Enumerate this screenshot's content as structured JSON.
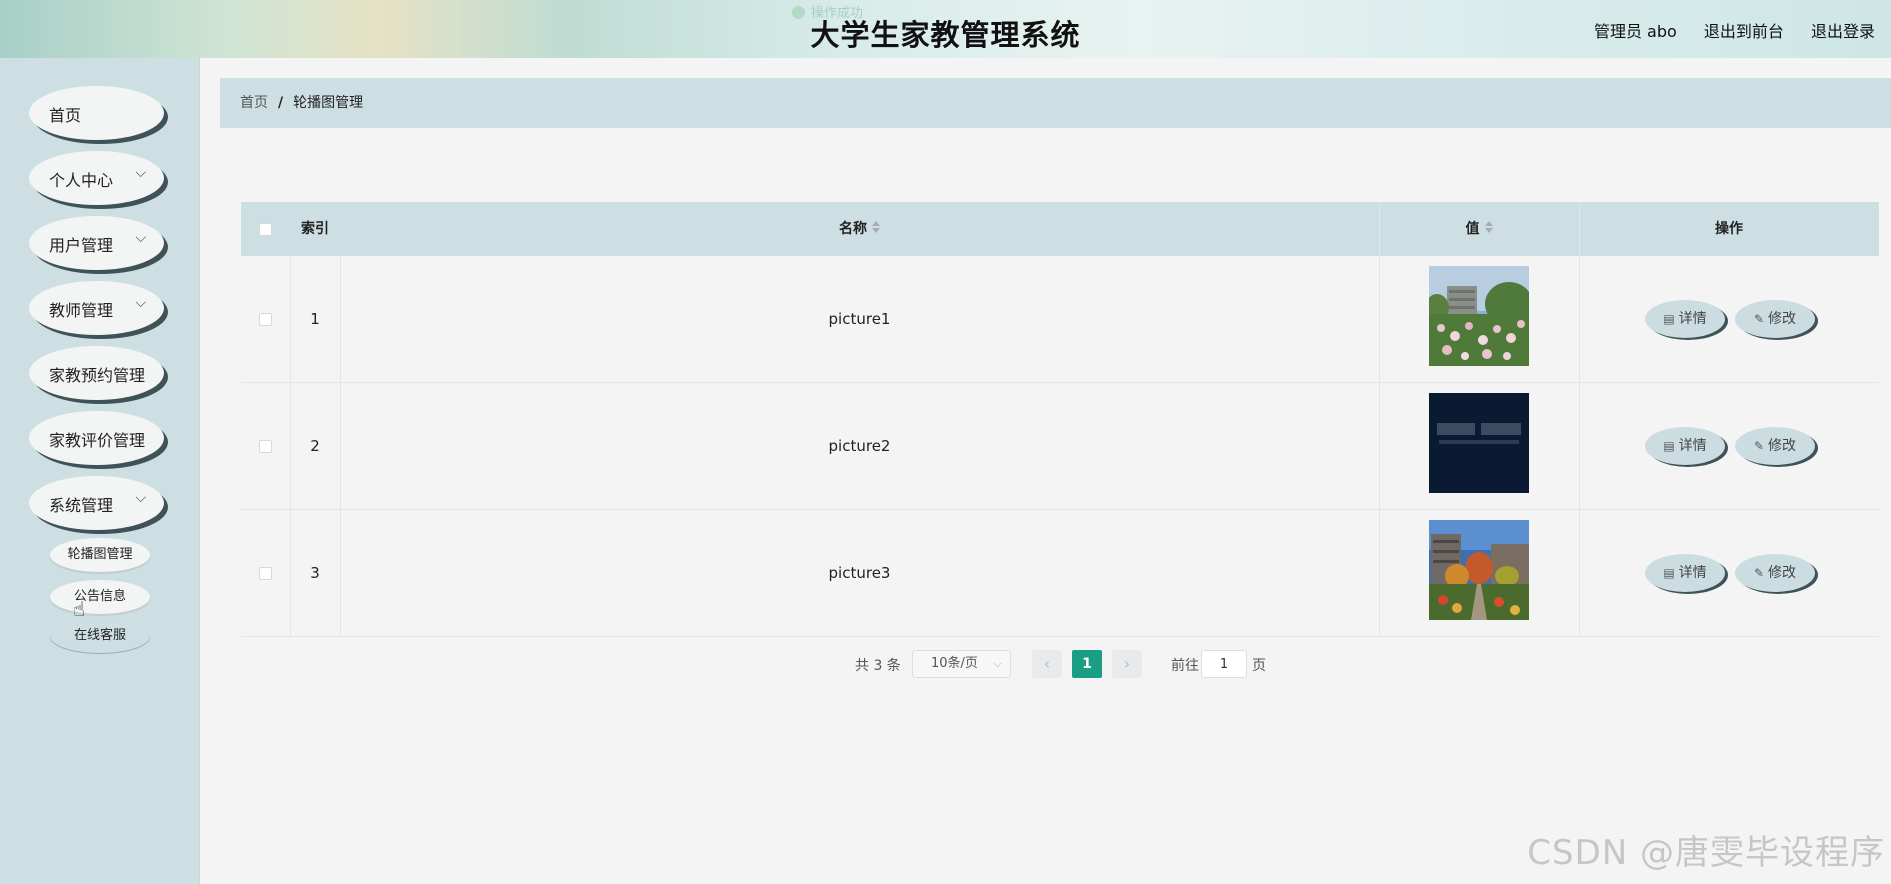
{
  "header": {
    "title": "大学生家教管理系统",
    "toast": "操作成功",
    "user": "管理员 abo",
    "to_front": "退出到前台",
    "logout": "退出登录"
  },
  "sidebar": {
    "items": [
      {
        "label": "首页",
        "has_children": false
      },
      {
        "label": "个人中心",
        "has_children": true
      },
      {
        "label": "用户管理",
        "has_children": true
      },
      {
        "label": "教师管理",
        "has_children": true
      },
      {
        "label": "家教预约管理",
        "has_children": false
      },
      {
        "label": "家教评价管理",
        "has_children": false
      },
      {
        "label": "系统管理",
        "has_children": true,
        "expanded": true
      }
    ],
    "subitems": [
      {
        "label": "轮播图管理"
      },
      {
        "label": "公告信息"
      },
      {
        "label": "在线客服"
      }
    ]
  },
  "breadcrumb": {
    "home": "首页",
    "separator": "/",
    "current": "轮播图管理"
  },
  "table": {
    "headers": {
      "index": "索引",
      "name": "名称",
      "value": "值",
      "actions": "操作"
    },
    "rows": [
      {
        "index": "1",
        "name": "picture1"
      },
      {
        "index": "2",
        "name": "picture2"
      },
      {
        "index": "3",
        "name": "picture3"
      }
    ],
    "detail_label": "详情",
    "edit_label": "修改"
  },
  "pagination": {
    "total": "共 3 条",
    "page_size": "10条/页",
    "current_page": "1",
    "goto_label": "前往",
    "goto_value": "1",
    "page_suffix": "页"
  },
  "watermark": "CSDN @唐雯毕设程序",
  "colors": {
    "accent": "#1a9e84",
    "sidebar_bg": "#cddfe3",
    "button_shadow": "#3f5257"
  }
}
